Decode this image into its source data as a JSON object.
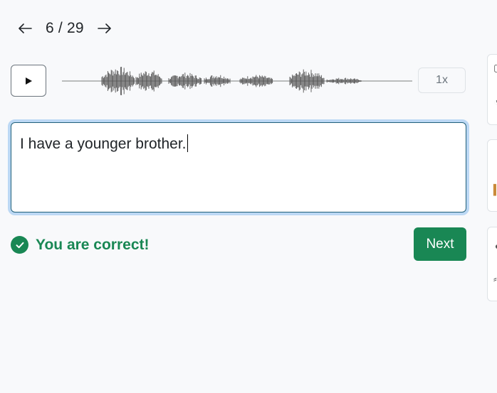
{
  "pager": {
    "current": "6",
    "separator": "/",
    "total": "29",
    "label": "6 / 29",
    "prev_icon": "arrow-left-icon",
    "next_icon": "arrow-right-icon"
  },
  "player": {
    "play_icon": "play-icon",
    "speed_label": "1x"
  },
  "answer": {
    "value": "I have a younger brother."
  },
  "feedback": {
    "icon": "check-circle-icon",
    "text": "You are correct!",
    "color": "#198754"
  },
  "actions": {
    "next_label": "Next",
    "next_color": "#198754"
  },
  "colors": {
    "background": "#f8f9fb",
    "focus_ring": "#bcd8f4",
    "input_border": "#1f5f7a",
    "waveform": "#555555"
  }
}
